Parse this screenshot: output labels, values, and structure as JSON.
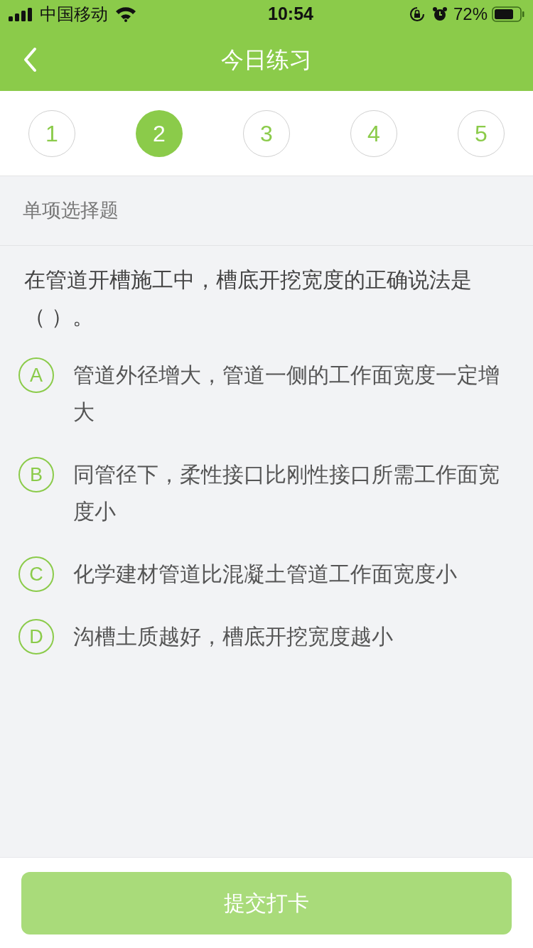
{
  "status_bar": {
    "carrier": "中国移动",
    "time": "10:54",
    "battery": "72%"
  },
  "nav": {
    "title": "今日练习"
  },
  "steps": [
    {
      "label": "1",
      "selected": false
    },
    {
      "label": "2",
      "selected": true
    },
    {
      "label": "3",
      "selected": false
    },
    {
      "label": "4",
      "selected": false
    },
    {
      "label": "5",
      "selected": false
    }
  ],
  "question": {
    "type": "单项选择题",
    "text": "在管道开槽施工中，槽底开挖宽度的正确说法是（  ）。",
    "options": [
      {
        "letter": "A",
        "text": "管道外径增大，管道一侧的工作面宽度一定增大",
        "selected": false
      },
      {
        "letter": "B",
        "text": "同管径下，柔性接口比刚性接口所需工作面宽度小",
        "selected": false
      },
      {
        "letter": "C",
        "text": "化学建材管道比混凝土管道工作面宽度小",
        "selected": false
      },
      {
        "letter": "D",
        "text": "沟槽土质越好，槽底开挖宽度越小",
        "selected": false
      }
    ]
  },
  "submit": {
    "label": "提交打卡",
    "disabled": true
  }
}
